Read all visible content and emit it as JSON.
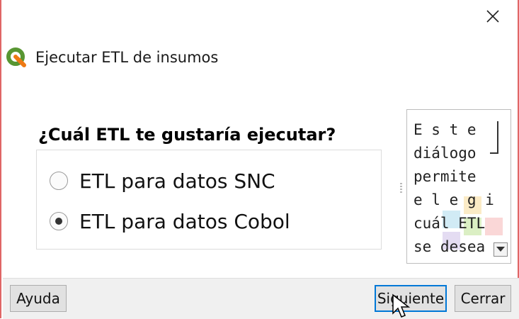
{
  "window": {
    "title": "Ejecutar ETL de insumos",
    "close_icon": "close-icon",
    "app_icon": "qgis-icon"
  },
  "main": {
    "question": "¿Cuál ETL te gustaría ejecutar?",
    "options": [
      {
        "label": "ETL para datos SNC",
        "selected": false
      },
      {
        "label": "ETL para datos Cobol",
        "selected": true
      }
    ]
  },
  "help_panel": {
    "lines": [
      "E s t e",
      "diálogo",
      "permite",
      "e l e g i r",
      "cuál  ETL",
      "se desea"
    ],
    "scroll_icon": "chevron-down-icon"
  },
  "buttons": {
    "help_label": "Ayuda",
    "next_label": "Siguiente",
    "close_label": "Cerrar"
  },
  "colors": {
    "window_border": "#e06666",
    "button_focus": "#0078d7",
    "qgis_green": "#589632",
    "qgis_yellow": "#ee7913"
  }
}
